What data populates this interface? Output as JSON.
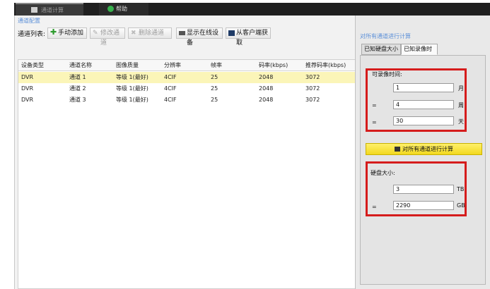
{
  "tabs": {
    "calc_label": "通道计算",
    "help_label": "帮助"
  },
  "left": {
    "section_title": "通道配置",
    "toolbar": {
      "list_label": "通道列表:",
      "add_label": "手动添加",
      "edit_label": "修改通道",
      "delete_label": "删除通道",
      "online_label": "显示在线设备",
      "client_label": "从客户端获取"
    },
    "table": {
      "headers": [
        "设备类型",
        "通道名称",
        "图像质量",
        "分辨率",
        "帧率",
        "码率(kbps)",
        "推荐码率(kbps)"
      ],
      "rows": [
        [
          "DVR",
          "通道 1",
          "等级 1(最好)",
          "4CIF",
          "25",
          "2048",
          "3072"
        ],
        [
          "DVR",
          "通道 2",
          "等级 1(最好)",
          "4CIF",
          "25",
          "2048",
          "3072"
        ],
        [
          "DVR",
          "通道 3",
          "等级 1(最好)",
          "4CIF",
          "25",
          "2048",
          "3072"
        ]
      ],
      "selected_row": 0
    }
  },
  "right": {
    "section_title": "对所有通道进行计算",
    "tab_size": "已知硬盘大小",
    "tab_time": "已知录像时间",
    "time_group": {
      "label": "可录像时间:",
      "months": "1",
      "months_unit": "月",
      "weeks": "4",
      "weeks_unit": "周",
      "days": "30",
      "days_unit": "天",
      "eq": "="
    },
    "calc_button": "对所有通道进行计算",
    "disk_group": {
      "label": "硬盘大小:",
      "tb": "3",
      "tb_unit": "TB",
      "gb": "2290",
      "gb_unit": "GB",
      "eq": "="
    }
  },
  "colors": {
    "highlight": "#d51c1c",
    "selected_row": "#fbf5b8",
    "calc_button": "#f2d81e"
  }
}
